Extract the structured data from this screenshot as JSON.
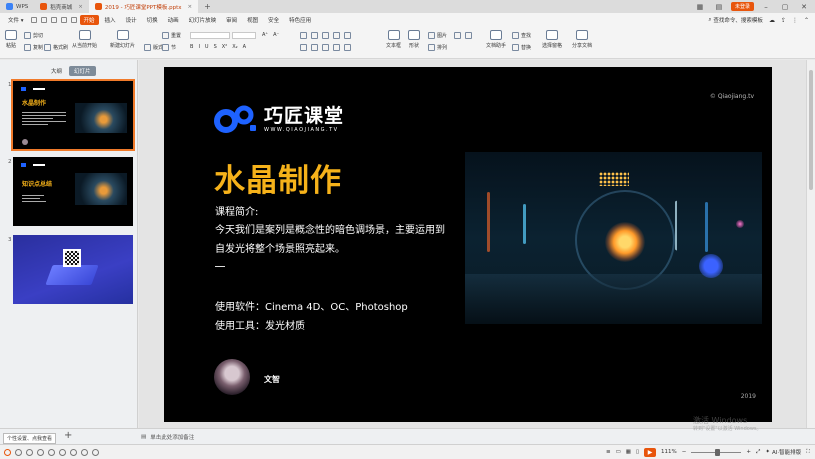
{
  "tabs": [
    {
      "label": "WPS",
      "color": "#3b82f6"
    },
    {
      "label": "稻壳商城",
      "color": "#e8550c"
    },
    {
      "label": "2019 - 巧匠课堂PPT模板.pptx",
      "color": "#e8550c",
      "active": true
    }
  ],
  "login_label": "未登录",
  "menu": {
    "file": "文件",
    "items": [
      "开始",
      "插入",
      "设计",
      "切换",
      "动画",
      "幻灯片放映",
      "审阅",
      "视图",
      "安全",
      "特色应用"
    ],
    "active_index": 0,
    "search": "查找命令、搜索模板"
  },
  "ribbon": {
    "paste": "粘贴",
    "cut": "剪切",
    "copy": "复制",
    "format_painter": "格式刷",
    "from_current": "从当前开始",
    "new_slide": "新建幻灯片",
    "layout": "版式",
    "section": "节",
    "reset": "重置",
    "text_box": "文本框",
    "shape": "形状",
    "picture": "图片",
    "arrange": "排列",
    "doc_helper": "文档助手",
    "find": "查找",
    "replace": "替换",
    "select_pane": "选择窗格",
    "share": "分享文档"
  },
  "left_panel": {
    "view_tabs": [
      "大纲",
      "幻灯片"
    ],
    "active_view": 1,
    "slides": [
      {
        "num": "1",
        "title": "水晶制作"
      },
      {
        "num": "2",
        "title": "知识点总结"
      },
      {
        "num": "3"
      }
    ]
  },
  "slide": {
    "copyright": "© Qiaojiang.tv",
    "logo_main": "巧匠课堂",
    "logo_sub": "WWW.QIAOJIANG.TV",
    "title": "水晶制作",
    "intro_label": "课程简介:",
    "intro_line1": "今天我们是案列是概念性的暗色调场景，主要运用到",
    "intro_line2": "自发光将整个场景照亮起来。",
    "software": "使用软件：Cinema 4D、OC、Photoshop",
    "tools": "使用工具：发光材质",
    "author": "文智",
    "year": "2019"
  },
  "bottom": {
    "tip": "个性设置、点我查看",
    "notes_placeholder": "单击此处添加备注"
  },
  "watermark": {
    "line1": "激活 Windows",
    "line2": "转到\"设置\"以激活 Windows。"
  },
  "status": {
    "zoom": "111%",
    "ai_label": "AI·智能排版"
  },
  "colors": {
    "accent": "#e8550c",
    "title_gold": "#f6b21a",
    "logo_blue": "#1e62ff"
  }
}
